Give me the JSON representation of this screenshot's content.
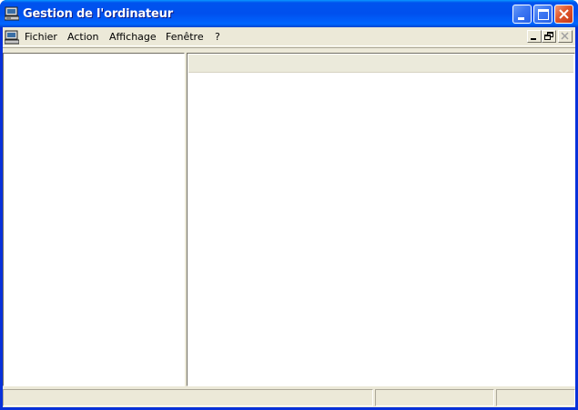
{
  "window": {
    "title": "Gestion de l'ordinateur",
    "icon": "computer-management-icon"
  },
  "caption_buttons": {
    "minimize_icon": "minimize-icon",
    "maximize_icon": "maximize-icon",
    "close_icon": "close-icon"
  },
  "menubar": {
    "icon": "console-icon",
    "items": [
      "Fichier",
      "Action",
      "Affichage",
      "Fenêtre",
      "?"
    ]
  },
  "mdi_buttons": {
    "minimize_icon": "mdi-minimize-icon",
    "restore_icon": "mdi-restore-icon",
    "close_icon": "mdi-close-icon"
  },
  "colors": {
    "titlebar": "#0053ee",
    "close_button": "#e0562b",
    "chrome": "#ece9d8"
  }
}
